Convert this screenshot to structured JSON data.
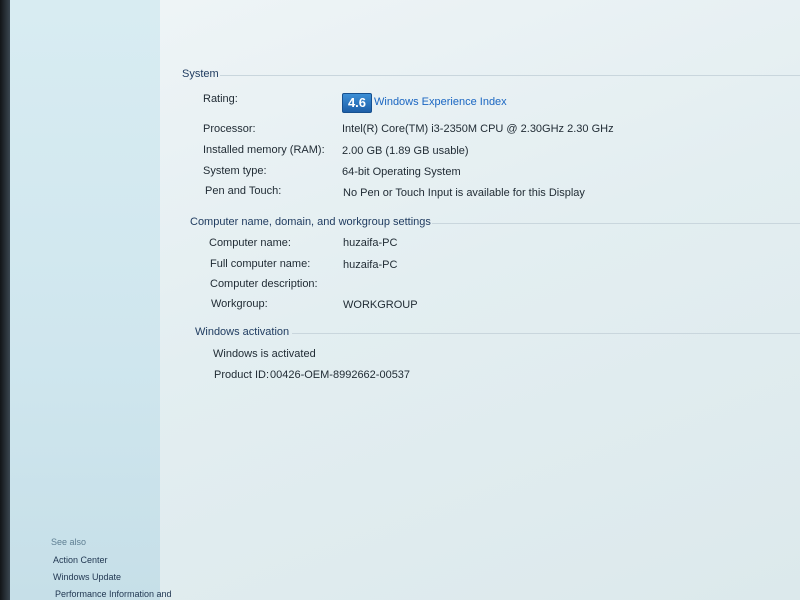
{
  "system": {
    "title": "System",
    "rating": {
      "label": "Rating:",
      "score": "4.6",
      "link": "Windows Experience Index"
    },
    "processor": {
      "label": "Processor:",
      "value": "Intel(R) Core(TM) i3-2350M CPU @ 2.30GHz   2.30 GHz"
    },
    "memory": {
      "label": "Installed memory (RAM):",
      "value": "2.00 GB (1.89 GB usable)"
    },
    "type": {
      "label": "System type:",
      "value": "64-bit Operating System"
    },
    "pen": {
      "label": "Pen and Touch:",
      "value": "No Pen or Touch Input is available for this Display"
    }
  },
  "computer": {
    "title": "Computer name, domain, and workgroup settings",
    "name": {
      "label": "Computer name:",
      "value": "huzaifa-PC"
    },
    "full_name": {
      "label": "Full computer name:",
      "value": "huzaifa-PC"
    },
    "description": {
      "label": "Computer description:",
      "value": ""
    },
    "workgroup": {
      "label": "Workgroup:",
      "value": "WORKGROUP"
    }
  },
  "activation": {
    "title": "Windows activation",
    "status": "Windows is activated",
    "product_id_label": "Product ID:",
    "product_id": "00426-OEM-8992662-00537"
  },
  "see_also": {
    "title": "See also",
    "items": [
      "Action Center",
      "Windows Update",
      "Performance Information and"
    ]
  }
}
